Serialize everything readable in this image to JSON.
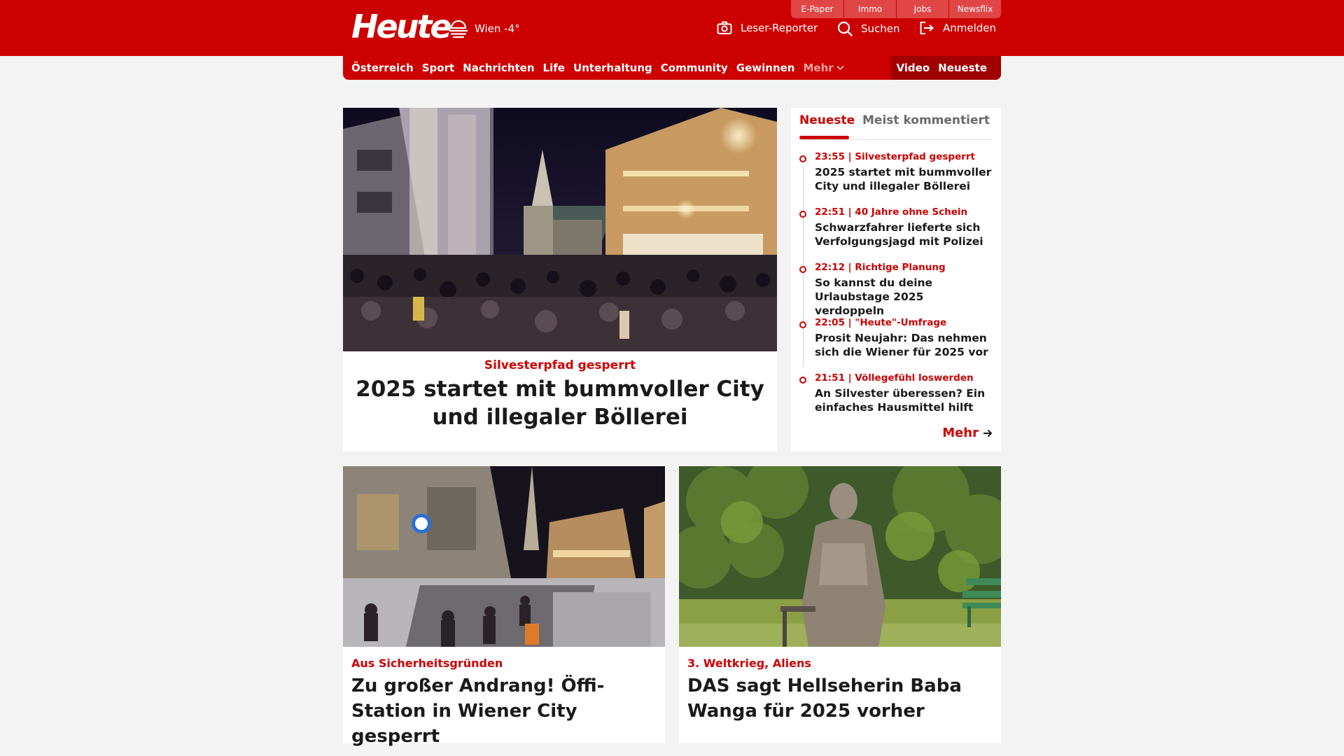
{
  "header": {
    "logo": "Heute",
    "weather": "Wien -4°",
    "top_links": [
      "E-Paper",
      "Immo",
      "Jobs",
      "Newsflix"
    ],
    "actions": {
      "reporter": "Leser-Reporter",
      "search": "Suchen",
      "login": "Anmelden"
    },
    "icons": [
      "weather-icon",
      "camera-icon",
      "search-icon",
      "login-icon"
    ]
  },
  "nav": {
    "items": [
      "Österreich",
      "Sport",
      "Nachrichten",
      "Life",
      "Unterhaltung",
      "Community",
      "Gewinnen"
    ],
    "more": "Mehr",
    "right": [
      "Video",
      "Neueste"
    ]
  },
  "hero": {
    "kicker": "Silvesterpfad gesperrt",
    "title": "2025 startet mit bummvoller City und illegaler Böllerei"
  },
  "sidebar": {
    "tabs": [
      "Neueste",
      "Meist kommentiert"
    ],
    "items": [
      {
        "meta": "23:55 | Silvesterpfad gesperrt",
        "title": "2025 startet mit bummvoller City und illegaler Böllerei"
      },
      {
        "meta": "22:51 | 40 Jahre ohne Schein",
        "title": "Schwarzfahrer lieferte sich Verfolgungsjagd mit Polizei"
      },
      {
        "meta": "22:12 | Richtige Planung",
        "title": "So kannst du deine Urlaubstage 2025 verdoppeln"
      },
      {
        "meta": "22:05 | \"Heute\"-Umfrage",
        "title": "Prosit Neujahr: Das nehmen sich die Wiener für 2025 vor"
      },
      {
        "meta": "21:51 | Völlegefühl loswerden",
        "title": "An Silvester überessen? Ein einfaches Hausmittel hilft"
      }
    ],
    "more": "Mehr"
  },
  "cards": [
    {
      "kicker": "Aus Sicherheitsgründen",
      "title": "Zu großer Andrang! Öffi-Station in Wiener City gesperrt"
    },
    {
      "kicker": "3. Weltkrieg, Aliens",
      "title": "DAS sagt Hellseherin Baba Wanga für 2025 vorher"
    }
  ],
  "colors": {
    "brand": "#cc0000",
    "brand_dark": "#a00000",
    "top_link_bg": "#e04646",
    "page_bg": "#f3f3f3"
  }
}
